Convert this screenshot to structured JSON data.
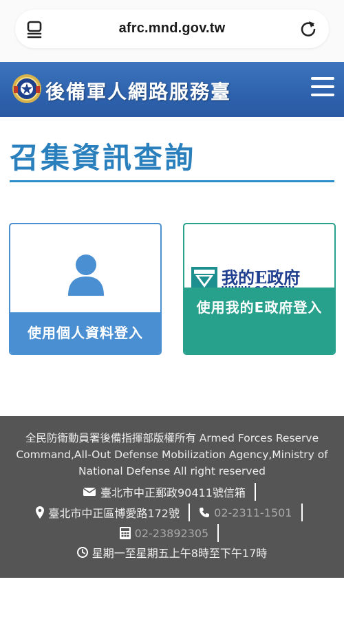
{
  "browser": {
    "url": "afrc.mnd.gov.tw",
    "reader_icon": "reader-mode-icon",
    "reload_icon": "reload-icon"
  },
  "header": {
    "title": "後備軍人網路服務臺",
    "logo_icon": "emblem-logo",
    "menu_icon": "hamburger-menu-icon",
    "bg_color": "#2e62ad"
  },
  "page": {
    "title": "召集資訊查詢",
    "title_color": "#2a7fbd"
  },
  "cards": {
    "personal": {
      "label": "使用個人資料登入",
      "icon": "person-icon",
      "color": "#4a8fd2"
    },
    "egov": {
      "label": "使用我的E政府登入",
      "logo_text": "我的E政府",
      "logo_sub": "WWW.GOV.TW",
      "color": "#27a08c"
    }
  },
  "footer": {
    "copyright": "全民防衛動員署後備指揮部版權所有 Armed Forces Reserve Command,All-Out Defense Mobilization Agency,Ministry of National Defense All right reserved",
    "mailbox": "臺北市中正郵政90411號信箱",
    "address": "臺北市中正區博愛路172號",
    "phone": "02-2311-1501",
    "fax": "02-23892305",
    "hours": "星期一至星期五上午8時至下午17時",
    "bg_color": "#555555"
  }
}
